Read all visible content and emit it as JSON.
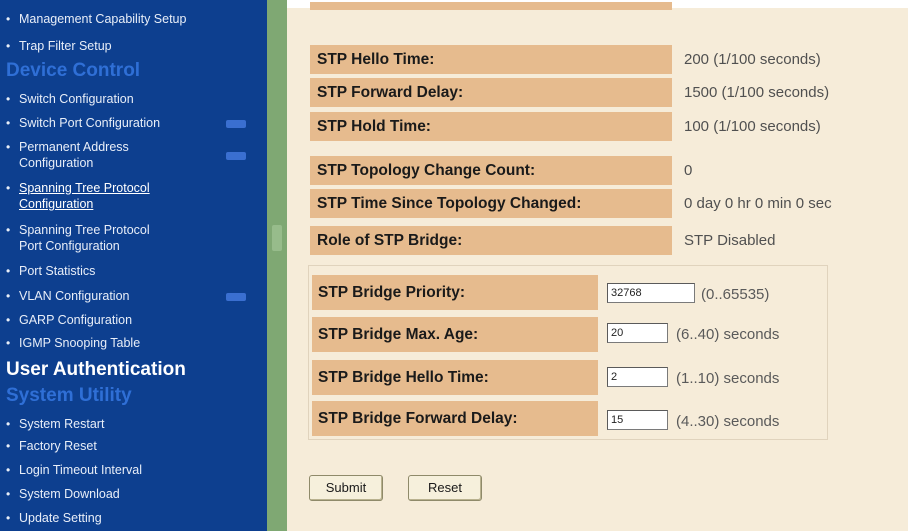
{
  "sidebar": {
    "items": [
      {
        "label": "Management Capability Setup"
      },
      {
        "label": "Trap Filter Setup"
      },
      {
        "heading": "Device Control"
      },
      {
        "label": "Switch Configuration"
      },
      {
        "label": "Switch Port Configuration"
      },
      {
        "label": "Permanent Address",
        "label2": "Configuration"
      },
      {
        "label": "Spanning Tree Protocol",
        "label2": "Configuration"
      },
      {
        "label": "Spanning Tree Protocol",
        "label2": "Port Configuration"
      },
      {
        "label": "Port Statistics"
      },
      {
        "label": "VLAN Configuration"
      },
      {
        "label": "GARP Configuration"
      },
      {
        "label": "IGMP Snooping Table"
      },
      {
        "heading": "User Authentication"
      },
      {
        "heading": "System Utility"
      },
      {
        "label": "System Restart"
      },
      {
        "label": "Factory Reset"
      },
      {
        "label": "Login Timeout Interval"
      },
      {
        "label": "System Download"
      },
      {
        "label": "Update Setting"
      }
    ]
  },
  "status": {
    "rows": [
      {
        "label": "STP Hello Time:",
        "value": "200  (1/100 seconds)"
      },
      {
        "label": "STP Forward Delay:",
        "value": "1500  (1/100 seconds)"
      },
      {
        "label": "STP Hold Time:",
        "value": "100  (1/100 seconds)"
      },
      {
        "label": "STP Topology Change Count:",
        "value": "0"
      },
      {
        "label": "STP Time Since Topology Changed:",
        "value": "0 day 0 hr 0 min 0 sec"
      },
      {
        "label": "Role of STP Bridge:",
        "value": "STP Disabled"
      }
    ]
  },
  "form": {
    "fields": [
      {
        "label": "STP Bridge Priority:",
        "value": "32768",
        "range": "(0..65535)"
      },
      {
        "label": "STP Bridge Max. Age:",
        "value": "20",
        "range": "(6..40) seconds"
      },
      {
        "label": "STP Bridge Hello Time:",
        "value": "2",
        "range": "(1..10) seconds"
      },
      {
        "label": "STP Bridge Forward Delay:",
        "value": "15",
        "range": "(4..30) seconds"
      }
    ],
    "submit_label": "Submit",
    "reset_label": "Reset"
  },
  "colors": {
    "sidebar_bg": "#0d3f8f",
    "heading_blue": "#2f6fd6",
    "label_bg": "#e6bb8e",
    "page_bg": "#f6ecd9",
    "divider": "#7fa873"
  }
}
